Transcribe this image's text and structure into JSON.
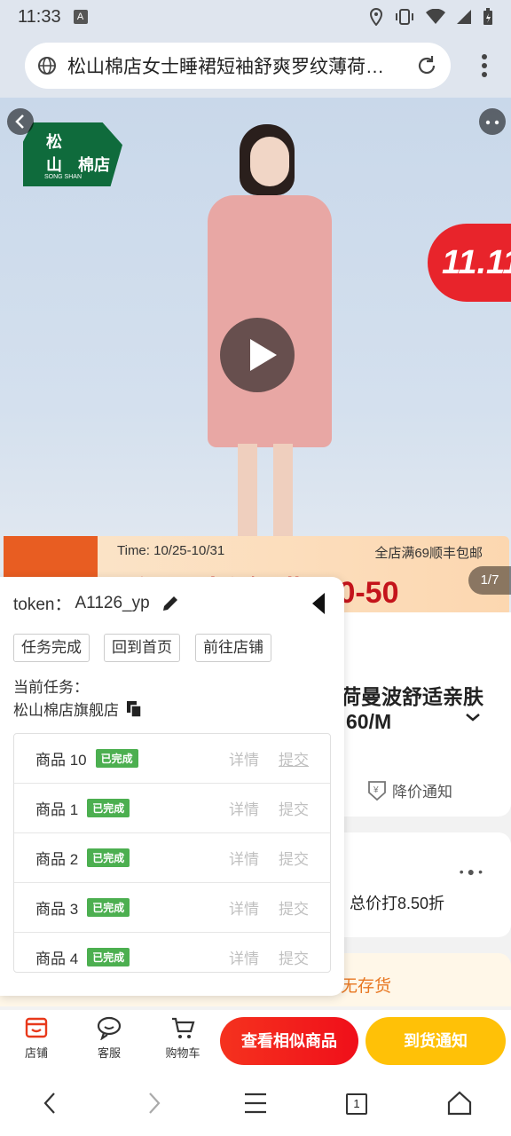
{
  "status": {
    "time": "11:33",
    "a_badge": "A"
  },
  "browser": {
    "url_title": "松山棉店女士睡裙短袖舒爽罗纹薄荷…"
  },
  "hero": {
    "logo": {
      "line1": "松",
      "line2": "山",
      "line3": "棉店",
      "line4": "SONG SHAN"
    },
    "double11": "11.11",
    "promo": {
      "time": "Time: 10/25-10/31",
      "shipping": "全店满69顺丰包邮",
      "headline": "2件 85折 每满300-50"
    },
    "counter": "1/7"
  },
  "product": {
    "title_visible": "荷曼波舒适亲肤",
    "size_visible": "60/M",
    "price_notice": "降价通知",
    "discount": "总价打8.50折",
    "stock": "无存货"
  },
  "actions": {
    "store": "店铺",
    "service": "客服",
    "cart": "购物车",
    "similar": "查看相似商品",
    "notify": "到货通知"
  },
  "panel": {
    "token_label": "token：",
    "token_value": "A1126_yp",
    "buttons": [
      "任务完成",
      "回到首页",
      "前往店铺"
    ],
    "current_label": "当前任务：",
    "current_task": "松山棉店旗舰店",
    "tasks": [
      {
        "name": "商品 10",
        "status": "已完成",
        "detail": "详情",
        "submit": "提交"
      },
      {
        "name": "商品 1",
        "status": "已完成",
        "detail": "详情",
        "submit": "提交"
      },
      {
        "name": "商品 2",
        "status": "已完成",
        "detail": "详情",
        "submit": "提交"
      },
      {
        "name": "商品 3",
        "status": "已完成",
        "detail": "详情",
        "submit": "提交"
      },
      {
        "name": "商品 4",
        "status": "已完成",
        "detail": "详情",
        "submit": "提交"
      }
    ]
  },
  "nav": {
    "tab_count": "1"
  },
  "colors": {
    "accent_red": "#f00f1a",
    "accent_yellow": "#ffc107",
    "badge_green": "#4caf50",
    "brand_green": "#0f6b3c"
  }
}
